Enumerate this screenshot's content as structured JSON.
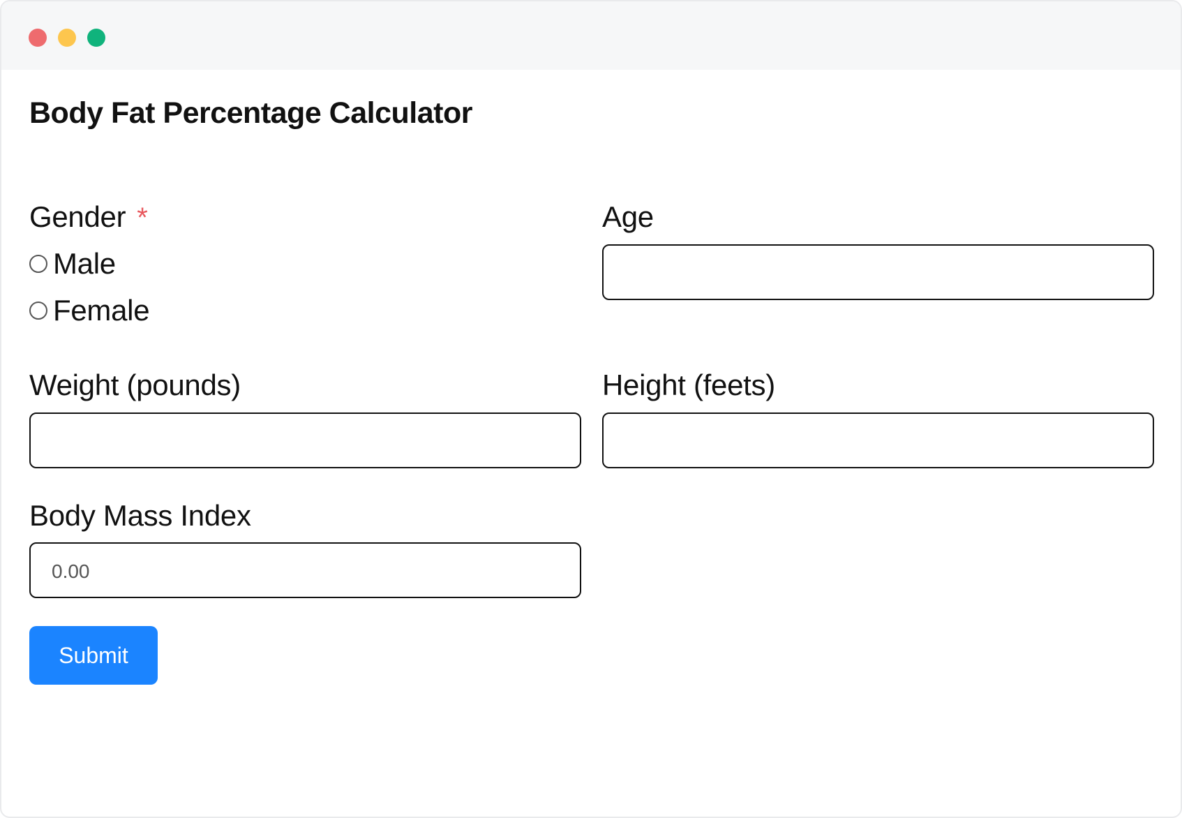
{
  "window": {
    "controls": [
      {
        "name": "close",
        "color": "#ee6b6e"
      },
      {
        "name": "minimize",
        "color": "#fdc64e"
      },
      {
        "name": "maximize",
        "color": "#10b37c"
      }
    ]
  },
  "form": {
    "title": "Body Fat Percentage Calculator",
    "gender": {
      "label": "Gender",
      "required_mark": "*",
      "options": [
        "Male",
        "Female"
      ]
    },
    "age": {
      "label": "Age",
      "value": ""
    },
    "weight": {
      "label": "Weight (pounds)",
      "value": ""
    },
    "height": {
      "label": "Height (feets)",
      "value": ""
    },
    "bmi": {
      "label": "Body Mass Index",
      "value": "0.00"
    },
    "submit_label": "Submit"
  },
  "colors": {
    "accent": "#1b84ff",
    "required": "#e8585d",
    "titlebar": "#f6f7f8"
  }
}
